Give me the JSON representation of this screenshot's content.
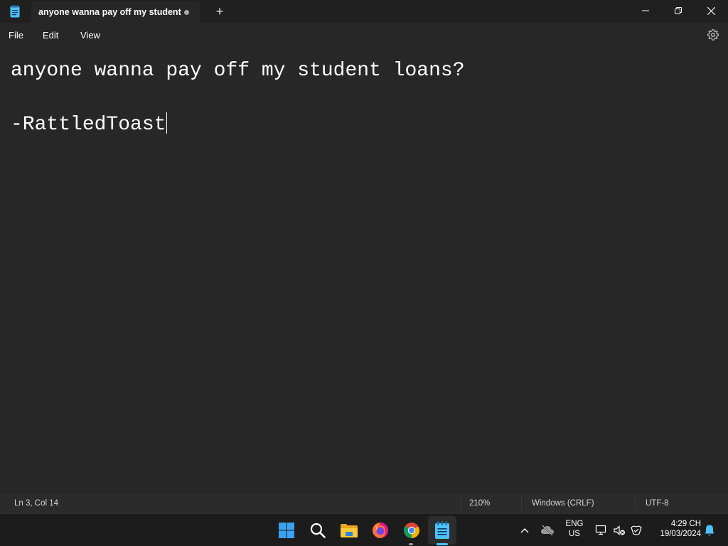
{
  "window": {
    "tab_title": "anyone wanna pay off my student",
    "new_tab_symbol": "+"
  },
  "menu": {
    "file": "File",
    "edit": "Edit",
    "view": "View"
  },
  "editor": {
    "lines": [
      "anyone wanna pay off my student loans?",
      "",
      "-RattledToast"
    ]
  },
  "status": {
    "position": "Ln 3, Col 14",
    "zoom": "210%",
    "line_ending": "Windows (CRLF)",
    "encoding": "UTF-8"
  },
  "taskbar": {
    "apps": [
      "start-icon",
      "search-icon",
      "file-explorer-icon",
      "firefox-icon",
      "chrome-icon",
      "notepad-icon"
    ],
    "tray": {
      "language_line1": "ENG",
      "language_line2": "US",
      "time": "4:29 CH",
      "date": "19/03/2024"
    }
  },
  "colors": {
    "background": "#272727",
    "titlebar": "#202020",
    "taskbar": "#1c1c1c",
    "accent": "#4cc2ff"
  }
}
